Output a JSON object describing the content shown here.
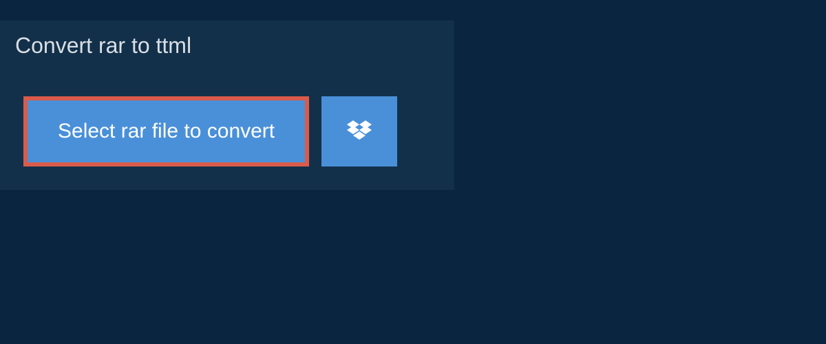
{
  "header": {
    "tab_label": "Convert rar to ttml"
  },
  "actions": {
    "select_file_label": "Select rar file to convert",
    "dropbox_icon_name": "dropbox-icon"
  },
  "colors": {
    "background": "#0a2540",
    "panel": "#13304a",
    "button_bg": "#4a90d9",
    "button_border": "#d95b4a",
    "text_light": "#d9dfe5",
    "text_white": "#ffffff"
  }
}
